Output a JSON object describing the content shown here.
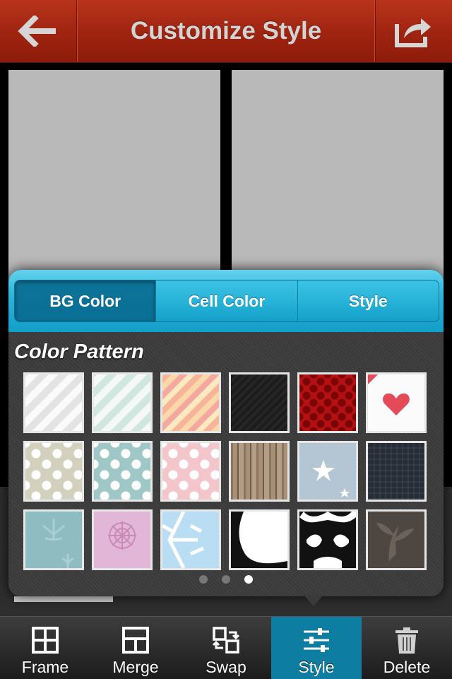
{
  "header": {
    "title": "Customize Style",
    "back_icon": "back-arrow-icon",
    "share_icon": "share-export-icon"
  },
  "panel": {
    "tabs": [
      {
        "label": "BG Color",
        "active": true
      },
      {
        "label": "Cell Color",
        "active": false
      },
      {
        "label": "Style",
        "active": false
      }
    ],
    "section_title": "Color Pattern",
    "patterns": [
      "white-diagonal-stripes",
      "mint-diagonal-stripes",
      "pastel-rainbow-stripes",
      "black-diagonal",
      "red-polka-dots",
      "white-heart",
      "beige-polka-dots",
      "teal-polka-dots",
      "pink-polka-dots",
      "wood-grain",
      "blue-stars",
      "navy-plaid",
      "teal-floral",
      "pink-mandala",
      "blue-snowflake",
      "black-white-grunge",
      "black-white-damask",
      "brown-leaf"
    ],
    "page_count": 3,
    "current_page": 3
  },
  "tabbar": {
    "items": [
      {
        "label": "Frame",
        "icon": "frame-grid-icon",
        "active": false
      },
      {
        "label": "Merge",
        "icon": "merge-icon",
        "active": false
      },
      {
        "label": "Swap",
        "icon": "swap-icon",
        "active": false
      },
      {
        "label": "Style",
        "icon": "style-sliders-icon",
        "active": true
      },
      {
        "label": "Delete",
        "icon": "trash-icon",
        "active": false
      }
    ]
  },
  "colors": {
    "header": "#a02812",
    "accent": "#13a0c9",
    "tab_active": "#0d7ea2"
  }
}
